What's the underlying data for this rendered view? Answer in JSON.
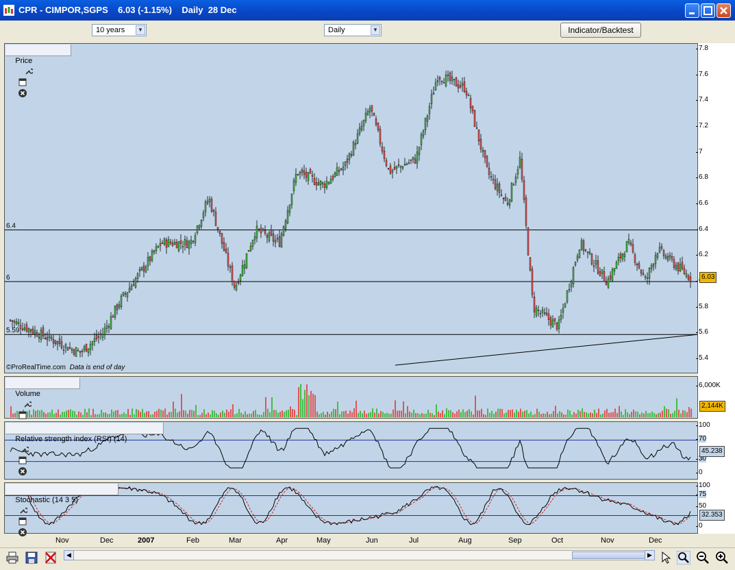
{
  "window": {
    "title": "CPR - CIMPOR,SGPS    6.03 (-1.15%)    Daily  28 Dec",
    "buttons": [
      "minimize",
      "maximize",
      "close"
    ]
  },
  "toolbar": {
    "range_select": "10 years",
    "interval_select": "Daily",
    "indicator_button": "Indicator/Backtest"
  },
  "panels": {
    "price": {
      "title": "Price",
      "watermark_brand": "©ProRealTime.com",
      "watermark_note": "Data is end of day",
      "last_badge": "6.03",
      "hlines": [
        {
          "label": "6.4",
          "value": 6.4
        },
        {
          "label": "6",
          "value": 6.0
        },
        {
          "label": "5.59",
          "value": 5.59
        }
      ],
      "trendline": {
        "from": {
          "x": "Jun",
          "y": 5.4
        },
        "to": {
          "x": "Dec",
          "y": 5.59
        }
      }
    },
    "volume": {
      "title": "Volume",
      "tick_top": "6,000K",
      "last_badge": "2,144K"
    },
    "rsi": {
      "title": "Relative strength index (RSI) (14)",
      "tick_100": "100",
      "tick_70": "70",
      "tick_30": "30",
      "tick_0": "0",
      "last_badge": "45.238"
    },
    "stochastic": {
      "title": "Stochastic (14 3 5)",
      "tick_100": "100",
      "tick_75": "75",
      "tick_50": "50",
      "tick_0": "0",
      "last_badge": "32.353"
    }
  },
  "price_axis": [
    "7.8",
    "7.6",
    "7.4",
    "7.2",
    "7",
    "6.8",
    "6.6",
    "6.4",
    "6.2",
    "6",
    "5.8",
    "5.6",
    "5.4"
  ],
  "x_axis": [
    "Nov",
    "Dec",
    "2007",
    "Feb",
    "Mar",
    "Apr",
    "May",
    "Jun",
    "Jul",
    "Aug",
    "Sep",
    "Oct",
    "Nov",
    "Dec"
  ],
  "colors": {
    "panel_bg": "#c2d5e8",
    "up": "#44bb44",
    "down": "#dd5555",
    "rsi_line": "#000000",
    "stoch_signal": "#cc2222",
    "band": "#2030a0",
    "badge_price": "#f2b800"
  },
  "chart_data": {
    "type": "candlestick",
    "title": "CPR - CIMPOR,SGPS",
    "ylim": [
      5.3,
      7.85
    ],
    "key_points": [
      {
        "x": "Nov",
        "y": 5.7
      },
      {
        "x": "Nov",
        "y": 5.45
      },
      {
        "x": "Dec",
        "y": 5.6
      },
      {
        "x": "Dec",
        "y": 5.85
      },
      {
        "x": "2007",
        "y": 6.3
      },
      {
        "x": "Feb",
        "y": 6.3
      },
      {
        "x": "Feb",
        "y": 6.65
      },
      {
        "x": "Mar",
        "y": 5.95
      },
      {
        "x": "Mar",
        "y": 6.4
      },
      {
        "x": "Apr",
        "y": 6.3
      },
      {
        "x": "Apr",
        "y": 6.85
      },
      {
        "x": "May",
        "y": 6.75
      },
      {
        "x": "May",
        "y": 6.9
      },
      {
        "x": "Jun",
        "y": 7.35
      },
      {
        "x": "Jun",
        "y": 6.85
      },
      {
        "x": "Jul",
        "y": 6.95
      },
      {
        "x": "Jul",
        "y": 7.6
      },
      {
        "x": "Aug",
        "y": 7.5
      },
      {
        "x": "Aug",
        "y": 6.85
      },
      {
        "x": "Sep",
        "y": 6.6
      },
      {
        "x": "Sep",
        "y": 6.95
      },
      {
        "x": "Sep",
        "y": 5.8
      },
      {
        "x": "Oct",
        "y": 5.65
      },
      {
        "x": "Oct",
        "y": 6.3
      },
      {
        "x": "Nov",
        "y": 6.0
      },
      {
        "x": "Nov",
        "y": 6.3
      },
      {
        "x": "Dec",
        "y": 6.0
      },
      {
        "x": "Dec",
        "y": 6.25
      },
      {
        "x": "Dec",
        "y": 6.03
      }
    ]
  }
}
